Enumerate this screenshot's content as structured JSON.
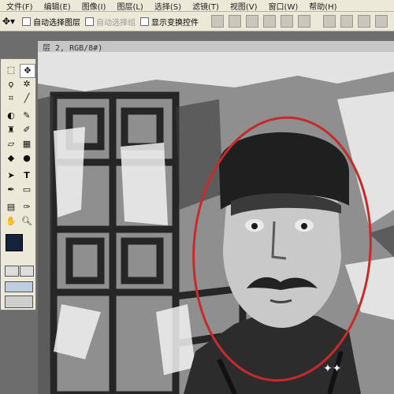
{
  "menu": {
    "items": [
      "文件(F)",
      "编辑(E)",
      "图像(I)",
      "图层(L)",
      "选择(S)",
      "滤镜(T)",
      "视图(V)",
      "窗口(W)",
      "帮助(H)"
    ]
  },
  "options": {
    "auto_select_layer": "自动选择图层",
    "auto_select_group": "自动选择组",
    "show_transform": "显示变换控件"
  },
  "document": {
    "tab_title": "层 2, RGB/8#)"
  },
  "colors": {
    "foreground": "#15233a",
    "background": "#ffffff",
    "highlight_ellipse": "#c62b2b"
  },
  "icons": {
    "move": "move-icon",
    "marquee": "marquee-icon",
    "lasso": "lasso-icon",
    "magic-wand": "magic-wand-icon",
    "crop": "crop-icon",
    "brush": "brush-icon",
    "stamp": "stamp-icon",
    "eraser": "eraser-icon",
    "gradient": "gradient-icon",
    "dodge": "dodge-icon",
    "path": "path-icon",
    "type": "type-icon",
    "pen": "pen-icon",
    "shape": "shape-icon",
    "notes": "notes-icon",
    "eyedropper": "eyedropper-icon",
    "hand": "hand-icon",
    "zoom": "zoom-icon"
  }
}
